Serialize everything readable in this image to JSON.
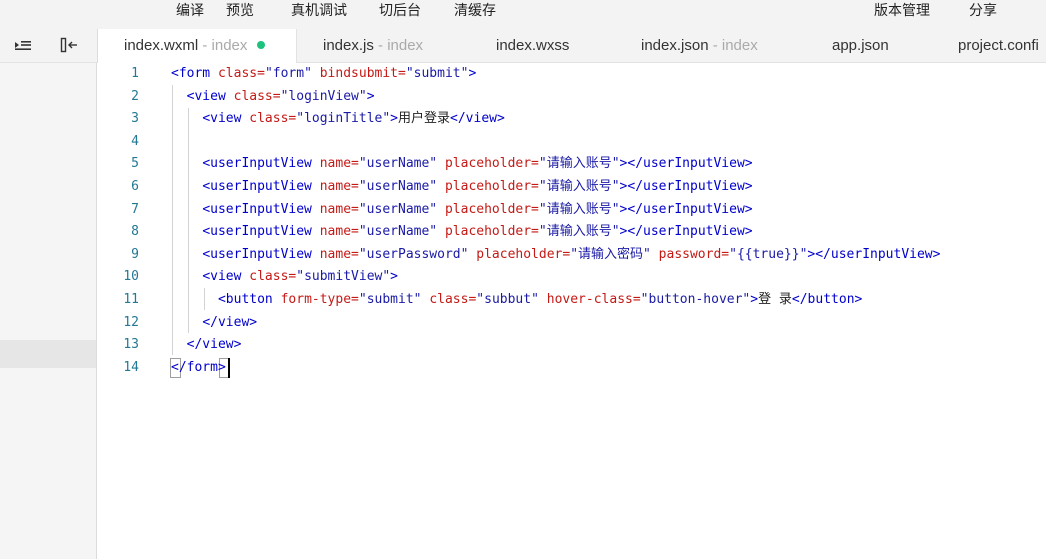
{
  "toolbar": {
    "left": [
      "编译",
      "预览",
      "真机调试",
      "切后台",
      "清缓存"
    ],
    "right": [
      "版本管理",
      "分享"
    ]
  },
  "tabs": [
    {
      "name": "index.wxml",
      "sub": " - index",
      "modified": true
    },
    {
      "name": "index.js",
      "sub": " - index"
    },
    {
      "name": "index.wxss",
      "sub": ""
    },
    {
      "name": "index.json",
      "sub": " - index"
    },
    {
      "name": "app.json",
      "sub": ""
    },
    {
      "name": "project.confi",
      "sub": ""
    }
  ],
  "icons": [
    "list-indent-icon",
    "collapse-panel-icon"
  ],
  "editor": {
    "lines": [
      [
        [
          "t",
          "<form "
        ],
        [
          "a",
          "class="
        ],
        [
          "v",
          "\"form\""
        ],
        [
          "t",
          " "
        ],
        [
          "a",
          "bindsubmit="
        ],
        [
          "v",
          "\"submit\""
        ],
        [
          "t",
          ">"
        ]
      ],
      [
        [
          "p",
          "  "
        ],
        [
          "t",
          "<view "
        ],
        [
          "a",
          "class="
        ],
        [
          "v",
          "\"loginView\""
        ],
        [
          "t",
          ">"
        ]
      ],
      [
        [
          "p",
          "    "
        ],
        [
          "t",
          "<view "
        ],
        [
          "a",
          "class="
        ],
        [
          "v",
          "\"loginTitle\""
        ],
        [
          "t",
          ">"
        ],
        [
          "p",
          "用户登录"
        ],
        [
          "t",
          "</view>"
        ]
      ],
      [],
      [
        [
          "p",
          "    "
        ],
        [
          "t",
          "<userInputView "
        ],
        [
          "a",
          "name="
        ],
        [
          "v",
          "\"userName\""
        ],
        [
          "t",
          " "
        ],
        [
          "a",
          "placeholder="
        ],
        [
          "v",
          "\"请输入账号\""
        ],
        [
          "t",
          "></userInputView>"
        ]
      ],
      [
        [
          "p",
          "    "
        ],
        [
          "t",
          "<userInputView "
        ],
        [
          "a",
          "name="
        ],
        [
          "v",
          "\"userName\""
        ],
        [
          "t",
          " "
        ],
        [
          "a",
          "placeholder="
        ],
        [
          "v",
          "\"请输入账号\""
        ],
        [
          "t",
          "></userInputView>"
        ]
      ],
      [
        [
          "p",
          "    "
        ],
        [
          "t",
          "<userInputView "
        ],
        [
          "a",
          "name="
        ],
        [
          "v",
          "\"userName\""
        ],
        [
          "t",
          " "
        ],
        [
          "a",
          "placeholder="
        ],
        [
          "v",
          "\"请输入账号\""
        ],
        [
          "t",
          "></userInputView>"
        ]
      ],
      [
        [
          "p",
          "    "
        ],
        [
          "t",
          "<userInputView "
        ],
        [
          "a",
          "name="
        ],
        [
          "v",
          "\"userName\""
        ],
        [
          "t",
          " "
        ],
        [
          "a",
          "placeholder="
        ],
        [
          "v",
          "\"请输入账号\""
        ],
        [
          "t",
          "></userInputView>"
        ]
      ],
      [
        [
          "p",
          "    "
        ],
        [
          "t",
          "<userInputView "
        ],
        [
          "a",
          "name="
        ],
        [
          "v",
          "\"userPassword\""
        ],
        [
          "t",
          " "
        ],
        [
          "a",
          "placeholder="
        ],
        [
          "v",
          "\"请输入密码\""
        ],
        [
          "t",
          " "
        ],
        [
          "a",
          "password="
        ],
        [
          "v",
          "\"{{true}}\""
        ],
        [
          "t",
          "></userInputView>"
        ]
      ],
      [
        [
          "p",
          "    "
        ],
        [
          "t",
          "<view "
        ],
        [
          "a",
          "class="
        ],
        [
          "v",
          "\"submitView\""
        ],
        [
          "t",
          ">"
        ]
      ],
      [
        [
          "p",
          "      "
        ],
        [
          "t",
          "<button "
        ],
        [
          "a",
          "form-type="
        ],
        [
          "v",
          "\"submit\""
        ],
        [
          "t",
          " "
        ],
        [
          "a",
          "class="
        ],
        [
          "v",
          "\"subbut\""
        ],
        [
          "t",
          " "
        ],
        [
          "a",
          "hover-class="
        ],
        [
          "v",
          "\"button-hover\""
        ],
        [
          "t",
          ">"
        ],
        [
          "p",
          "登 录"
        ],
        [
          "t",
          "</button>"
        ]
      ],
      [
        [
          "p",
          "    "
        ],
        [
          "t",
          "</view>"
        ]
      ],
      [
        [
          "p",
          "  "
        ],
        [
          "t",
          "</view>"
        ]
      ],
      [
        [
          "t",
          "</form>"
        ]
      ]
    ]
  }
}
